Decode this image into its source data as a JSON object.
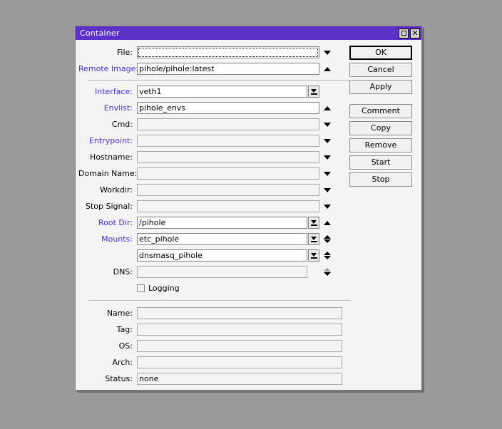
{
  "window": {
    "title": "Container",
    "controls": [
      {
        "name": "maximize-button",
        "icon": "square-icon"
      },
      {
        "name": "close-button",
        "icon": "close-icon"
      }
    ]
  },
  "form": {
    "groups": [
      {
        "rows": [
          {
            "label": "File:",
            "link": false,
            "value": "",
            "placeholder": "",
            "control": "focus-field",
            "trailing": "caret-down",
            "state": "focused"
          },
          {
            "label": "Remote Image:",
            "link": true,
            "value": "pihole/pihole:latest",
            "placeholder": "",
            "control": "text-field",
            "trailing": "caret-up",
            "state": "filled"
          }
        ]
      },
      {
        "rows": [
          {
            "label": "Interface:",
            "link": true,
            "value": "veth1",
            "placeholder": "",
            "control": "text-field",
            "trailing": "picker",
            "state": "filled"
          },
          {
            "label": "Envlist:",
            "link": true,
            "value": "pihole_envs",
            "placeholder": "",
            "control": "text-field",
            "trailing": "caret-up",
            "state": "filled"
          },
          {
            "label": "Cmd:",
            "link": false,
            "value": "",
            "placeholder": "",
            "control": "text-field",
            "trailing": "caret-down",
            "state": "empty"
          },
          {
            "label": "Entrypoint:",
            "link": true,
            "value": "",
            "placeholder": "",
            "control": "text-field",
            "trailing": "caret-down",
            "state": "empty"
          },
          {
            "label": "Hostname:",
            "link": false,
            "value": "",
            "placeholder": "",
            "control": "text-field",
            "trailing": "caret-down",
            "state": "empty"
          },
          {
            "label": "Domain Name:",
            "link": false,
            "value": "",
            "placeholder": "",
            "control": "text-field",
            "trailing": "caret-down",
            "state": "empty"
          },
          {
            "label": "Workdir:",
            "link": false,
            "value": "",
            "placeholder": "",
            "control": "text-field",
            "trailing": "caret-down",
            "state": "empty"
          },
          {
            "label": "Stop Signal:",
            "link": false,
            "value": "",
            "placeholder": "",
            "control": "text-field",
            "trailing": "caret-down",
            "state": "empty"
          },
          {
            "label": "Root Dir:",
            "link": true,
            "value": "/pihole",
            "placeholder": "",
            "control": "text-field",
            "trailing": "picker-caret-up",
            "state": "filled"
          },
          {
            "label": "Mounts:",
            "link": true,
            "value": "etc_pihole",
            "placeholder": "",
            "control": "text-field",
            "trailing": "picker-spinner",
            "state": "filled"
          },
          {
            "label": "",
            "link": false,
            "value": "dnsmasq_pihole",
            "placeholder": "",
            "control": "text-field",
            "trailing": "picker-spinner",
            "state": "filled"
          },
          {
            "label": "DNS:",
            "link": false,
            "value": "",
            "placeholder": "",
            "control": "text-field",
            "trailing": "spinner-dim",
            "state": "empty"
          }
        ]
      }
    ],
    "checkbox": {
      "label": "Logging",
      "checked": false
    },
    "info_rows": [
      {
        "label": "Name:",
        "value": ""
      },
      {
        "label": "Tag:",
        "value": ""
      },
      {
        "label": "OS:",
        "value": ""
      },
      {
        "label": "Arch:",
        "value": ""
      },
      {
        "label": "Status:",
        "value": "none"
      }
    ]
  },
  "buttons": [
    {
      "label": "OK",
      "default": true
    },
    {
      "label": "Cancel",
      "default": false
    },
    {
      "label": "Apply",
      "default": false
    },
    {
      "label": "Comment",
      "default": false
    },
    {
      "label": "Copy",
      "default": false
    },
    {
      "label": "Remove",
      "default": false
    },
    {
      "label": "Start",
      "default": false
    },
    {
      "label": "Stop",
      "default": false
    }
  ],
  "colors": {
    "titlebar": "#5b32c8",
    "link_label": "#4b2ce0",
    "window_bg": "#f4f4f4",
    "desktop_bg": "#9b9b9b"
  }
}
